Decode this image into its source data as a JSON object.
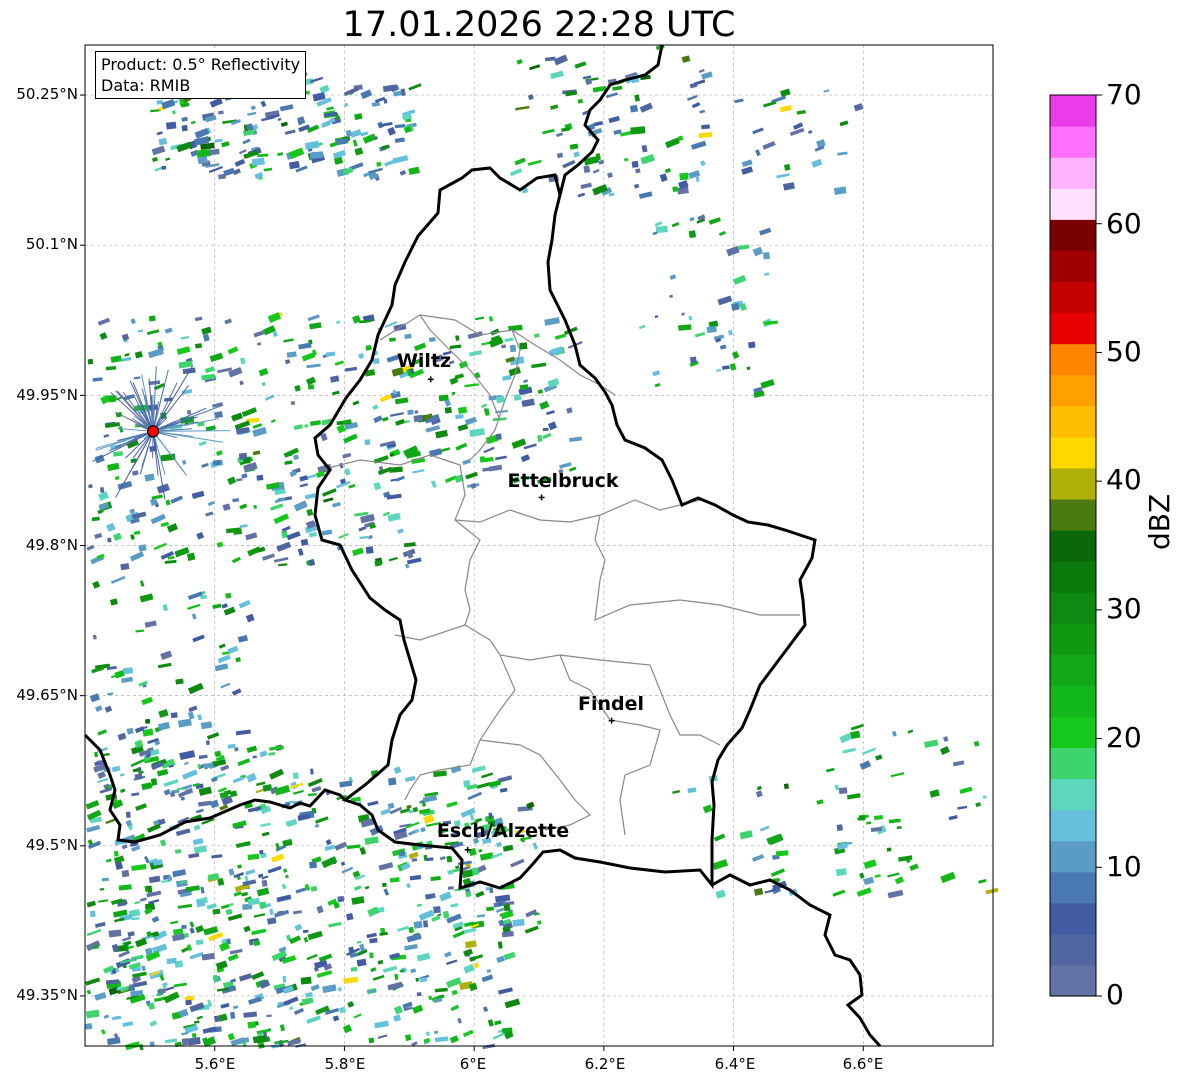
{
  "title": "17.01.2026 22:28 UTC",
  "info": {
    "product": "Product: 0.5° Reflectivity",
    "source": "Data: RMIB"
  },
  "axes": {
    "lat_labels": [
      "50.25°N",
      "50.1°N",
      "49.95°N",
      "49.8°N",
      "49.65°N",
      "49.5°N",
      "49.35°N"
    ],
    "lon_labels": [
      "5.6°E",
      "5.8°E",
      "6°E",
      "6.2°E",
      "6.4°E",
      "6.6°E"
    ]
  },
  "map": {
    "lon_range": [
      5.4,
      6.8
    ],
    "lat_range": [
      49.3,
      50.3
    ],
    "radar_site": {
      "lon": 5.505,
      "lat": 49.914,
      "color": "#ff0000"
    },
    "cities": [
      {
        "name": "Wiltz",
        "lon": 5.933,
        "lat": 49.966
      },
      {
        "name": "Ettelbruck",
        "lon": 6.104,
        "lat": 49.848
      },
      {
        "name": "Findel",
        "lon": 6.212,
        "lat": 49.625
      },
      {
        "name": "Esch/Alzette",
        "lon": 5.99,
        "lat": 49.496
      }
    ]
  },
  "colorbar": {
    "label": "dBZ",
    "ticks": [
      "70",
      "60",
      "50",
      "40",
      "30",
      "20",
      "10",
      "0"
    ],
    "vmin": 0,
    "vmax": 70,
    "colors": [
      "#6272a4",
      "#5165a0",
      "#425ca4",
      "#4a78b0",
      "#5a9cc5",
      "#64c0dc",
      "#5dd6c0",
      "#3dd46e",
      "#16c81c",
      "#12b81a",
      "#11a817",
      "#0f9812",
      "#0e8a10",
      "#0b7a0c",
      "#0a680a",
      "#4a7a10",
      "#afb00a",
      "#ffd800",
      "#ffbe00",
      "#ffa000",
      "#ff8400",
      "#e60000",
      "#c40000",
      "#a00000",
      "#7a0000",
      "#ffe0ff",
      "#ffb2ff",
      "#ff70ff",
      "#ea3cea"
    ]
  }
}
